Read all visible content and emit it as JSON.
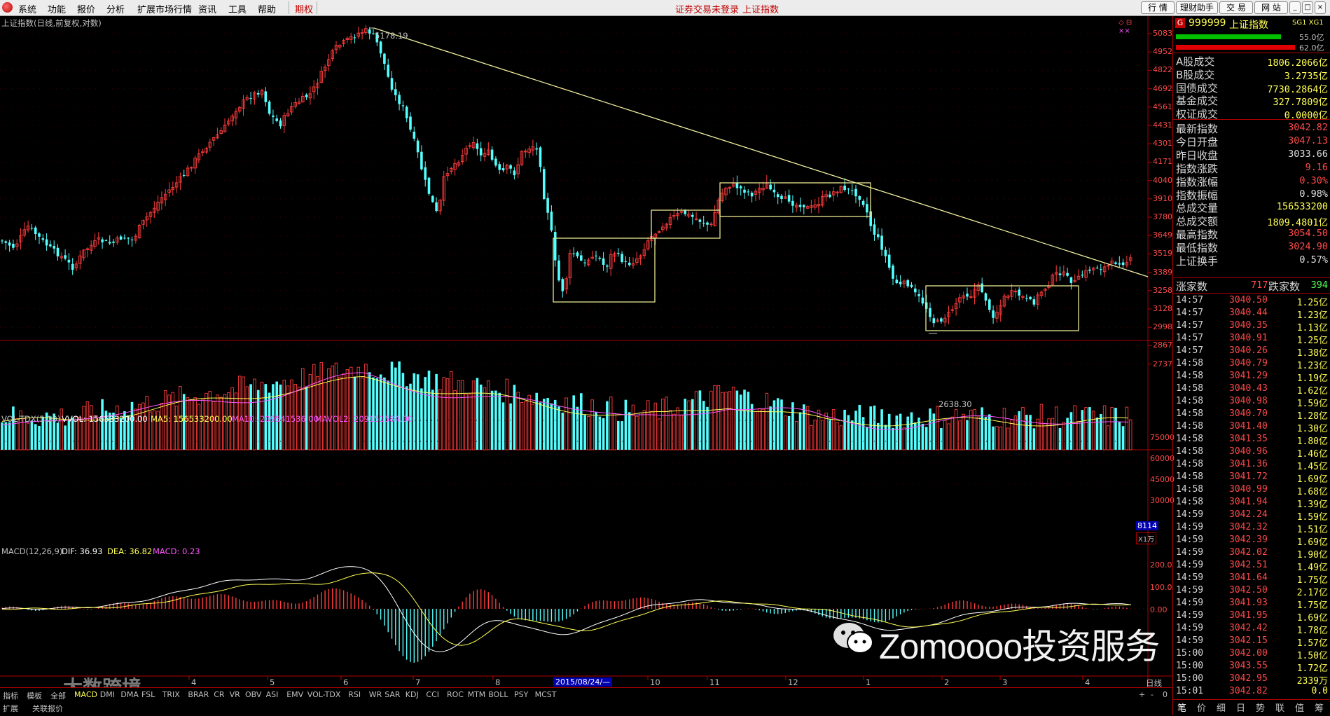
{
  "menu": {
    "items": [
      "系统",
      "功能",
      "报价",
      "分析",
      "扩展市场行情",
      "资讯",
      "工具",
      "帮助"
    ],
    "highlight": "期权",
    "status_text": "证券交易未登录",
    "index_text": "上证指数",
    "buttons": [
      "行 情",
      "理财助手",
      "交 易",
      "网 站"
    ]
  },
  "chart": {
    "title": "上证指数(日线,前复权,对数)",
    "peak_label": "5178.19",
    "low_label": "2638.30",
    "price_ticks": [
      "5083",
      "4952",
      "4822",
      "4692",
      "4561",
      "4431",
      "4301",
      "4171",
      "4040",
      "3910",
      "3780",
      "3649",
      "3519",
      "3389",
      "3258",
      "3128",
      "2998",
      "2867",
      "2737"
    ],
    "volume_header": {
      "name": "VOL-TDX(5,10)",
      "vvol": "VVOL: 156533200.00",
      "ma5": "MA5: 156533200.00",
      "ma10": "MA10: 209541536.00",
      "mavol2": "MAVOL2: 209151584.00"
    },
    "volume_ticks": [
      "75000",
      "60000",
      "45000",
      "30000"
    ],
    "volume_unit": "X1万",
    "volume_current": "8114",
    "macd_header": {
      "name": "MACD(12,26,9)",
      "dif": "DIF: 36.93",
      "dea": "DEA: 36.82",
      "macd": "MACD: 0.23"
    },
    "macd_ticks": [
      "200.0",
      "100.0",
      "0.00"
    ],
    "x_months": [
      "4",
      "5",
      "6",
      "7",
      "8",
      "10",
      "11",
      "12",
      "1",
      "2",
      "3",
      "4"
    ],
    "x_date_marker": "2015/08/24/—",
    "period": "日线",
    "indicator_tabs": [
      "指标",
      "模板",
      "全部",
      "MACD",
      "DMI",
      "DMA",
      "FSL",
      "TRIX",
      "BRAR",
      "CR",
      "VR",
      "OBV",
      "ASI",
      "EMV",
      "VOL-TDX",
      "RSI",
      "WR",
      "SAR",
      "KDJ",
      "CCI",
      "ROC",
      "MTM",
      "BOLL",
      "PSY",
      "MCST"
    ],
    "bottom_tabs": [
      "扩展",
      "关联报价"
    ],
    "watermark": "Zomoooo投资服务",
    "watermark2": "大数跨境"
  },
  "colors": {
    "up": "#ff3c3c",
    "down": "#54ffff",
    "trendline": "#f0f0a0",
    "box": "#e8e890",
    "axis": "#b00000",
    "yellow": "#ffff54",
    "magenta": "#ff54ff"
  },
  "panel": {
    "code": "999999",
    "name": "上证指数",
    "tag": "SG1 XG1",
    "bar1": "55.0亿",
    "bar2": "62.0亿",
    "volumes": [
      {
        "k": "A股成交",
        "v": "1806.2066亿"
      },
      {
        "k": "B股成交",
        "v": "3.2735亿"
      },
      {
        "k": "国债成交",
        "v": "7730.2864亿"
      },
      {
        "k": "基金成交",
        "v": "327.7809亿"
      },
      {
        "k": "权证成交",
        "v": "0.0000亿"
      }
    ],
    "stats": [
      {
        "k": "最新指数",
        "v": "3042.82",
        "c": "#ff4a4a"
      },
      {
        "k": "今日开盘",
        "v": "3047.13",
        "c": "#ff4a4a"
      },
      {
        "k": "昨日收盘",
        "v": "3033.66",
        "c": "#e0e0e0"
      },
      {
        "k": "指数涨跌",
        "v": "9.16",
        "c": "#ff4a4a"
      },
      {
        "k": "指数涨幅",
        "v": "0.30%",
        "c": "#ff4a4a"
      },
      {
        "k": "指数振幅",
        "v": "0.98%",
        "c": "#e0e0e0"
      },
      {
        "k": "总成交量",
        "v": "156533200",
        "c": "#ffff54"
      },
      {
        "k": "总成交额",
        "v": "1809.4801亿",
        "c": "#ffff54"
      },
      {
        "k": "最高指数",
        "v": "3054.50",
        "c": "#ff4a4a"
      },
      {
        "k": "最低指数",
        "v": "3024.90",
        "c": "#ff4a4a"
      },
      {
        "k": "上证换手",
        "v": "0.57%",
        "c": "#e0e0e0"
      }
    ],
    "up_label": "涨家数",
    "up_count": "717",
    "down_label": "跌家数",
    "down_count": "394",
    "ticks": [
      {
        "t": "14:57",
        "p": "3040.50",
        "v": "1.25亿"
      },
      {
        "t": "14:57",
        "p": "3040.44",
        "v": "1.23亿"
      },
      {
        "t": "14:57",
        "p": "3040.35",
        "v": "1.13亿"
      },
      {
        "t": "14:57",
        "p": "3040.91",
        "v": "1.25亿"
      },
      {
        "t": "14:57",
        "p": "3040.26",
        "v": "1.38亿"
      },
      {
        "t": "14:58",
        "p": "3040.79",
        "v": "1.23亿"
      },
      {
        "t": "14:58",
        "p": "3041.29",
        "v": "1.19亿"
      },
      {
        "t": "14:58",
        "p": "3040.43",
        "v": "1.62亿"
      },
      {
        "t": "14:58",
        "p": "3040.98",
        "v": "1.59亿"
      },
      {
        "t": "14:58",
        "p": "3040.70",
        "v": "1.28亿"
      },
      {
        "t": "14:58",
        "p": "3041.40",
        "v": "1.30亿"
      },
      {
        "t": "14:58",
        "p": "3041.35",
        "v": "1.80亿"
      },
      {
        "t": "14:58",
        "p": "3040.96",
        "v": "1.46亿"
      },
      {
        "t": "14:58",
        "p": "3041.36",
        "v": "1.45亿"
      },
      {
        "t": "14:58",
        "p": "3041.72",
        "v": "1.69亿"
      },
      {
        "t": "14:58",
        "p": "3040.99",
        "v": "1.68亿"
      },
      {
        "t": "14:58",
        "p": "3041.94",
        "v": "1.39亿"
      },
      {
        "t": "14:59",
        "p": "3042.24",
        "v": "1.59亿"
      },
      {
        "t": "14:59",
        "p": "3042.32",
        "v": "1.51亿"
      },
      {
        "t": "14:59",
        "p": "3042.39",
        "v": "1.69亿"
      },
      {
        "t": "14:59",
        "p": "3042.02",
        "v": "1.90亿"
      },
      {
        "t": "14:59",
        "p": "3042.51",
        "v": "1.49亿"
      },
      {
        "t": "14:59",
        "p": "3041.64",
        "v": "1.75亿"
      },
      {
        "t": "14:59",
        "p": "3042.50",
        "v": "2.17亿"
      },
      {
        "t": "14:59",
        "p": "3041.93",
        "v": "1.75亿"
      },
      {
        "t": "14:59",
        "p": "3041.95",
        "v": "1.69亿"
      },
      {
        "t": "14:59",
        "p": "3042.42",
        "v": "1.78亿"
      },
      {
        "t": "14:59",
        "p": "3042.15",
        "v": "1.57亿"
      },
      {
        "t": "15:00",
        "p": "3042.00",
        "v": "1.50亿"
      },
      {
        "t": "15:00",
        "p": "3043.55",
        "v": "1.72亿"
      },
      {
        "t": "15:00",
        "p": "3042.95",
        "v": "2339万"
      },
      {
        "t": "15:01",
        "p": "3042.82",
        "v": "0.0"
      }
    ],
    "tabs": [
      "笔",
      "价",
      "细",
      "日",
      "势",
      "联",
      "值",
      "筹"
    ]
  }
}
